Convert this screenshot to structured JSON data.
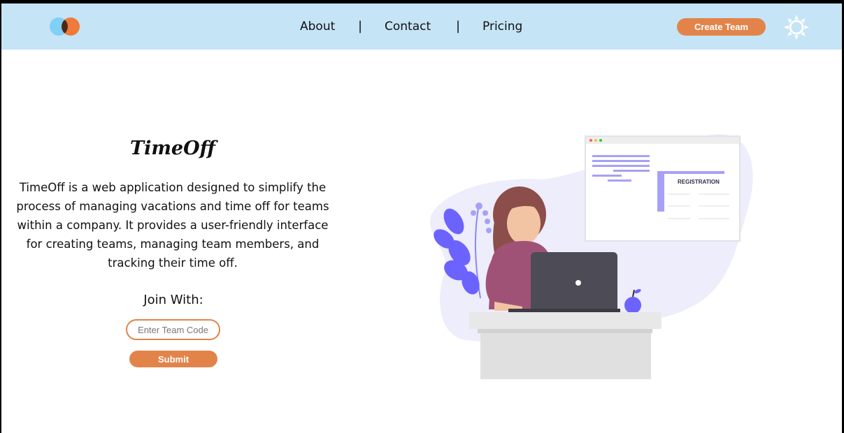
{
  "nav": {
    "links": [
      "About",
      "Contact",
      "Pricing"
    ],
    "separator": "|",
    "create_team_label": "Create Team"
  },
  "hero": {
    "title": "TimeOff",
    "description": "TimeOff is a web application designed to simplify the process of managing vacations and time off for teams within a company. It provides a user-friendly interface for creating teams, managing team members, and tracking their time off.",
    "join_label": "Join With:",
    "team_code_placeholder": "Enter Team Code",
    "submit_label": "Submit"
  },
  "illustration": {
    "form_heading": "REGISTRATION"
  },
  "colors": {
    "navbar_bg": "#c5e4f6",
    "accent": "#e2844a",
    "illustration_purple": "#6c63ff"
  },
  "icons": {
    "logo": "overlapping-circles-logo",
    "theme_toggle": "sun-icon"
  }
}
